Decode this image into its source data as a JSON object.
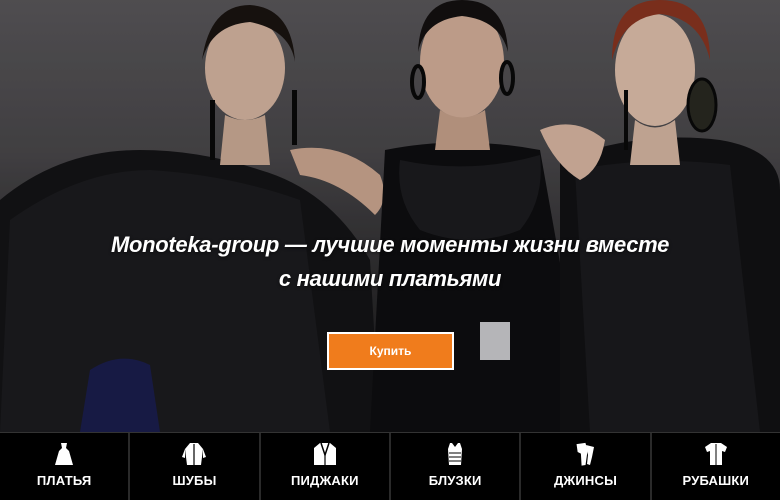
{
  "hero": {
    "headline_line1": "Monoteka-group — лучшие моменты жизни вместе",
    "headline_line2": "с нашими платьями",
    "buy_label": "Купить",
    "accent_color": "#f07c1c"
  },
  "categories": [
    {
      "label": "ПЛАТЬЯ",
      "icon": "dress-icon"
    },
    {
      "label": "ШУБЫ",
      "icon": "fur-coat-icon"
    },
    {
      "label": "ПИДЖАКИ",
      "icon": "jacket-icon"
    },
    {
      "label": "БЛУЗКИ",
      "icon": "blouse-icon"
    },
    {
      "label": "ДЖИНСЫ",
      "icon": "jeans-icon"
    },
    {
      "label": "РУБАШКИ",
      "icon": "shirt-icon"
    }
  ]
}
